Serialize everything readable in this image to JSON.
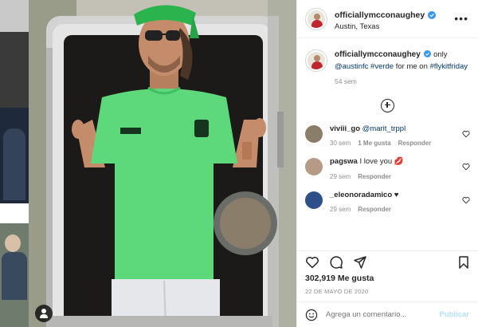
{
  "post": {
    "username": "officiallymcconaughey",
    "location": "Austin, Texas",
    "more_icon": "more-horizontal-icon"
  },
  "caption": {
    "username": "officiallymcconaughey",
    "text_before": "only",
    "tag1": "@austinfc",
    "tag2": "#verde",
    "text_after": "for me on",
    "tag3": "#flykitfriday",
    "time": "54 sem"
  },
  "comments": [
    {
      "username": "viviii_go",
      "text": "",
      "mention": "@marit_trppl",
      "time": "30 sem",
      "likes": "1 Me gusta",
      "reply": "Responder",
      "avatar_color": "#8a7d6a"
    },
    {
      "username": "pagswa",
      "text": "I love you",
      "emoji": "💋",
      "mention": "",
      "time": "29 sem",
      "likes": "",
      "reply": "Responder",
      "avatar_color": "#b79a86"
    },
    {
      "username": "_eleonoradamico",
      "text": "",
      "emoji": "♥",
      "mention": "",
      "time": "29 sem",
      "likes": "",
      "reply": "Responder",
      "avatar_color": "#2f4f8a"
    }
  ],
  "actions": {
    "likes": "302,919 Me gusta",
    "date": "22 DE MAYO DE 2020"
  },
  "add_comment": {
    "placeholder": "Agrega un comentario...",
    "post_label": "Publicar"
  },
  "colors": {
    "verified": "#3897f0",
    "link": "#00376b",
    "muted": "#8e8e8e",
    "post_disabled": "#b2dffc",
    "shirt_green": "#5dd87a"
  }
}
